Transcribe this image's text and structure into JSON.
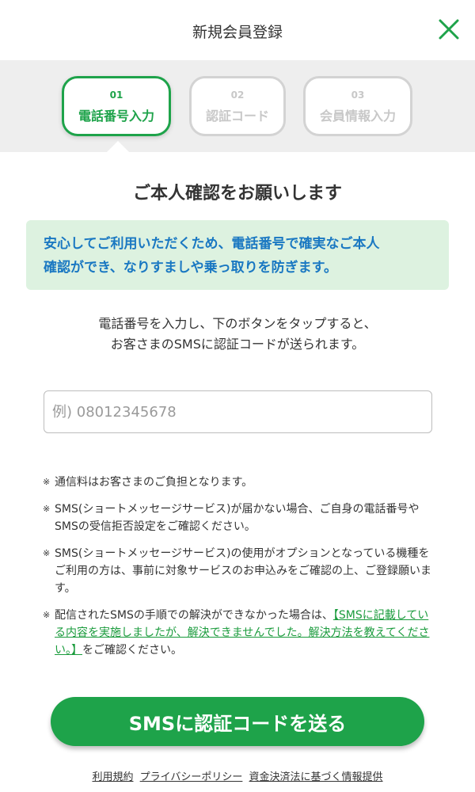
{
  "header": {
    "title": "新規会員登録",
    "close_icon": "close-icon",
    "accent_color": "#1ea34a"
  },
  "steps": [
    {
      "number": "01",
      "label": "電話番号入力",
      "state": "active"
    },
    {
      "number": "02",
      "label": "認証コード",
      "state": "inactive"
    },
    {
      "number": "03",
      "label": "会員情報入力",
      "state": "inactive"
    }
  ],
  "main": {
    "heading": "ご本人確認をお願いします",
    "notice": {
      "line1": "安心してご利用いただくため、電話番号で確実なご本人",
      "line2": "確認ができ、なりすましや乗っ取りを防ぎます。"
    },
    "instruction": {
      "line1": "電話番号を入力し、下のボタンをタップすると、",
      "line2": "お客さまのSMSに認証コードが送られます。"
    },
    "phone_input": {
      "placeholder": "例) 08012345678",
      "value": ""
    },
    "notes": {
      "mark": "※",
      "note1": "通信料はお客さまのご負担となります。",
      "note2": "SMS(ショートメッセージサービス)が届かない場合、ご自身の電話番号やSMSの受信拒否設定をご確認ください。",
      "note3": "SMS(ショートメッセージサービス)の使用がオプションとなっている機種をご利用の方は、事前に対象サービスのお申込みをご確認の上、ご登録願います。",
      "note4_prefix": "配信されたSMSの手順での解決ができなかった場合は、",
      "note4_link": "【SMSに記載している内容を実施しましたが、解決できませんでした。解決方法を教えてください。】",
      "note4_suffix": "をご確認ください。"
    },
    "submit_button": "SMSに認証コードを送る"
  },
  "footer": {
    "links": [
      "利用規約",
      "プライバシーポリシー",
      "資金決済法に基づく情報提供"
    ]
  }
}
